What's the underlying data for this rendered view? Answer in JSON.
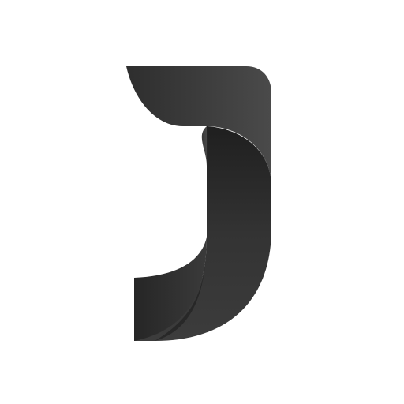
{
  "logo": {
    "icon": "folded-ribbon-j-logo-icon",
    "colors": {
      "background": "#ffffff",
      "top_band_light": "#4a4a4a",
      "top_band_dark": "#2e2e2e",
      "stem_light": "#3c3c3c",
      "stem_dark": "#1f1f1f",
      "fold_shadow": "#151515",
      "foot_light": "#3a3a3a",
      "foot_dark": "#262626"
    }
  }
}
